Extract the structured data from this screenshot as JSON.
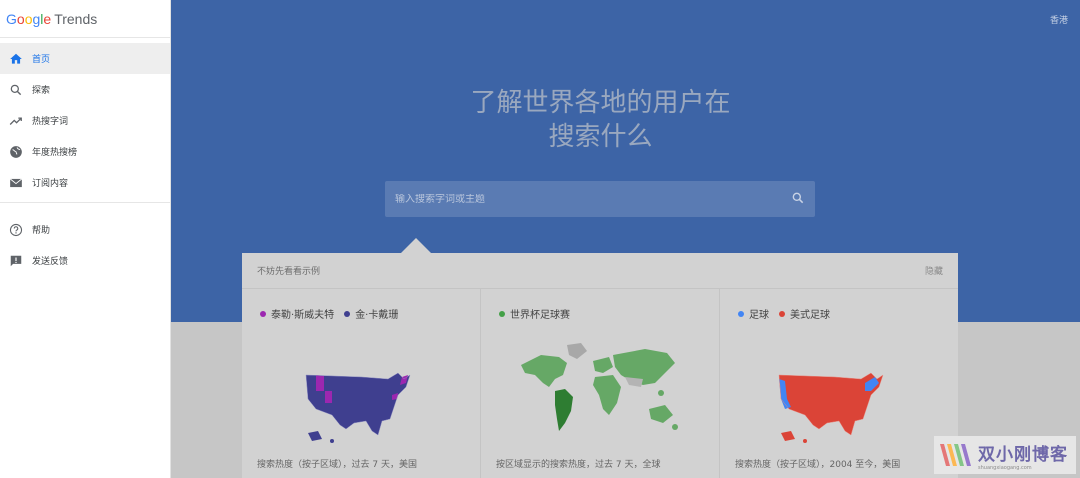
{
  "brand": {
    "google": "Google",
    "trends": "Trends"
  },
  "nav": {
    "items": [
      {
        "label": "首页",
        "icon": "home-icon",
        "active": true
      },
      {
        "label": "探索",
        "icon": "search-icon"
      },
      {
        "label": "热搜字词",
        "icon": "trending-icon"
      },
      {
        "label": "年度热搜榜",
        "icon": "globe-icon"
      },
      {
        "label": "订阅内容",
        "icon": "mail-icon"
      }
    ],
    "secondary": [
      {
        "label": "帮助",
        "icon": "help-icon"
      },
      {
        "label": "发送反馈",
        "icon": "feedback-icon"
      }
    ]
  },
  "hero": {
    "region": "香港",
    "title_line1": "了解世界各地的用户在",
    "title_line2": "搜索什么",
    "search_placeholder": "输入搜索字词或主题"
  },
  "examples": {
    "title": "不妨先看看示例",
    "hide_label": "隐藏",
    "cards": [
      {
        "legend": [
          {
            "label": "泰勒·斯威夫特",
            "color": "#9c27b0"
          },
          {
            "label": "金·卡戴珊",
            "color": "#3f3f8f"
          }
        ],
        "caption": "搜索热度（按子区域），过去 7 天，美国"
      },
      {
        "legend": [
          {
            "label": "世界杯足球赛",
            "color": "#43a047"
          }
        ],
        "caption": "按区域显示的搜索热度，过去 7 天，全球"
      },
      {
        "legend": [
          {
            "label": "足球",
            "color": "#4285f4"
          },
          {
            "label": "美式足球",
            "color": "#db4437"
          }
        ],
        "caption": "搜索热度（按子区域），2004 至今，美国"
      }
    ]
  },
  "watermark": {
    "title": "双小刚博客",
    "url": "shuangxiaogang.com"
  },
  "colors": {
    "hero": "#3d64a6",
    "panel": "#d2d2d2",
    "accent": "#1a73e8"
  }
}
